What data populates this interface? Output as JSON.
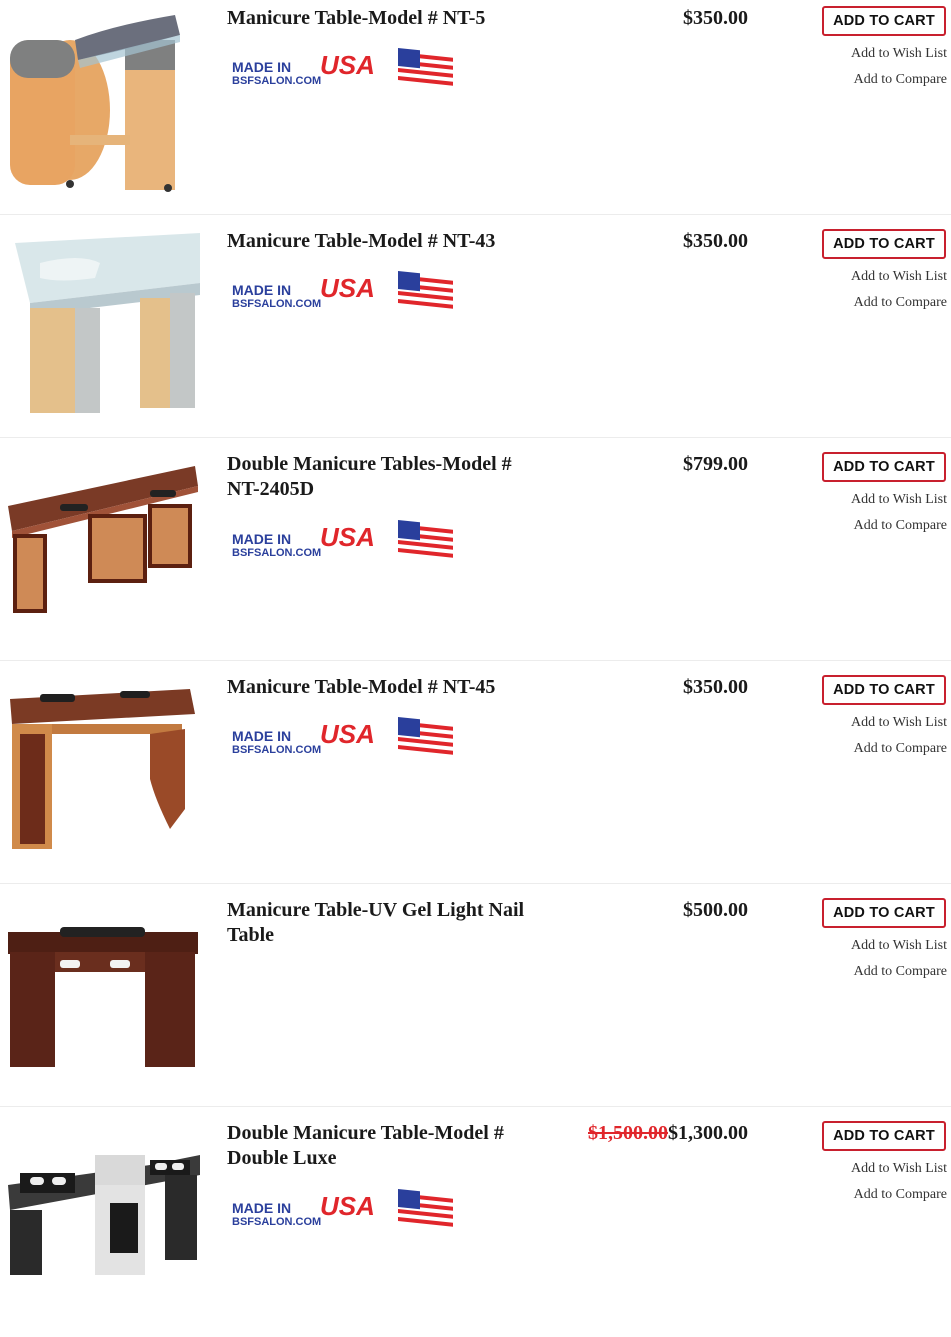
{
  "products": [
    {
      "title": "Manicure Table-Model # NT-5",
      "price": "$350.00",
      "badge": true,
      "badge_text": {
        "made": "MADE IN",
        "usa": "USA",
        "site": "BSFSALON.COM"
      }
    },
    {
      "title": "Manicure Table-Model # NT-43",
      "price": "$350.00",
      "badge": true,
      "badge_text": {
        "made": "MADE IN",
        "usa": "USA",
        "site": "BSFSALON.COM"
      }
    },
    {
      "title": "Double Manicure Tables-Model # NT-2405D",
      "price": "$799.00",
      "badge": true,
      "badge_text": {
        "made": "MADE IN",
        "usa": "USA",
        "site": "BSFSALON.COM"
      }
    },
    {
      "title": "Manicure Table-Model # NT-45",
      "price": "$350.00",
      "badge": true,
      "badge_text": {
        "made": "MADE IN",
        "usa": "USA",
        "site": "BSFSALON.COM"
      }
    },
    {
      "title": "Manicure Table-UV Gel Light Nail Table",
      "price": "$500.00",
      "badge": false
    },
    {
      "title": "Double Manicure Table-Model # Double Luxe",
      "old_price": "$1,500.00",
      "price": "$1,300.00",
      "badge": true,
      "badge_text": {
        "made": "MADE IN",
        "usa": "USA",
        "site": "BSFSALON.COM"
      }
    }
  ],
  "labels": {
    "add_to_cart": "ADD TO CART",
    "add_to_wish_list": "Add to Wish List",
    "add_to_compare": "Add to Compare"
  },
  "colors": {
    "accent_red": "#c8202e",
    "badge_blue": "#2a3f9c",
    "badge_red": "#e0262b"
  }
}
